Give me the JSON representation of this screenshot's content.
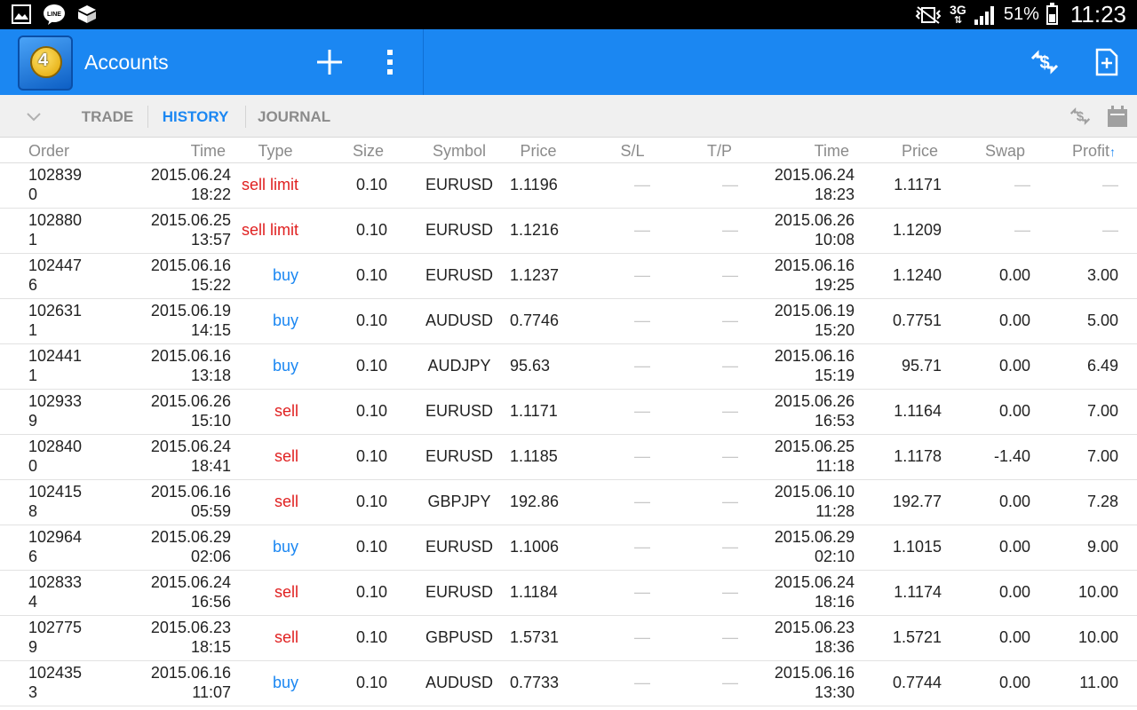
{
  "status_bar": {
    "battery": "51%",
    "network": "3G",
    "time": "11:23"
  },
  "action_bar": {
    "title": "Accounts"
  },
  "tabs": [
    {
      "label": "TRADE",
      "active": false
    },
    {
      "label": "HISTORY",
      "active": true
    },
    {
      "label": "JOURNAL",
      "active": false
    }
  ],
  "columns": {
    "order": "Order",
    "time": "Time",
    "type": "Type",
    "size": "Size",
    "symbol": "Symbol",
    "price": "Price",
    "sl": "S/L",
    "tp": "T/P",
    "close_time": "Time",
    "close_price": "Price",
    "swap": "Swap",
    "profit": "Profit",
    "sort_indicator": "↑"
  },
  "colors": {
    "accent": "#1b87f2",
    "buy": "#1b87f2",
    "sell": "#e02020"
  },
  "rows": [
    {
      "order_a": "102839",
      "order_b": "0",
      "date": "2015.06.24",
      "time": "18:22",
      "type": "sell limit",
      "size": "0.10",
      "symbol": "EURUSD",
      "price": "1.1196",
      "sl": "—",
      "tp": "—",
      "close_date": "2015.06.24",
      "close_time": "18:23",
      "close_price": "1.1171",
      "swap": "—",
      "profit": "—"
    },
    {
      "order_a": "102880",
      "order_b": "1",
      "date": "2015.06.25",
      "time": "13:57",
      "type": "sell limit",
      "size": "0.10",
      "symbol": "EURUSD",
      "price": "1.1216",
      "sl": "—",
      "tp": "—",
      "close_date": "2015.06.26",
      "close_time": "10:08",
      "close_price": "1.1209",
      "swap": "—",
      "profit": "—"
    },
    {
      "order_a": "102447",
      "order_b": "6",
      "date": "2015.06.16",
      "time": "15:22",
      "type": "buy",
      "size": "0.10",
      "symbol": "EURUSD",
      "price": "1.1237",
      "sl": "—",
      "tp": "—",
      "close_date": "2015.06.16",
      "close_time": "19:25",
      "close_price": "1.1240",
      "swap": "0.00",
      "profit": "3.00"
    },
    {
      "order_a": "102631",
      "order_b": "1",
      "date": "2015.06.19",
      "time": "14:15",
      "type": "buy",
      "size": "0.10",
      "symbol": "AUDUSD",
      "price": "0.7746",
      "sl": "—",
      "tp": "—",
      "close_date": "2015.06.19",
      "close_time": "15:20",
      "close_price": "0.7751",
      "swap": "0.00",
      "profit": "5.00"
    },
    {
      "order_a": "102441",
      "order_b": "1",
      "date": "2015.06.16",
      "time": "13:18",
      "type": "buy",
      "size": "0.10",
      "symbol": "AUDJPY",
      "price": "95.63",
      "sl": "—",
      "tp": "—",
      "close_date": "2015.06.16",
      "close_time": "15:19",
      "close_price": "95.71",
      "swap": "0.00",
      "profit": "6.49"
    },
    {
      "order_a": "102933",
      "order_b": "9",
      "date": "2015.06.26",
      "time": "15:10",
      "type": "sell",
      "size": "0.10",
      "symbol": "EURUSD",
      "price": "1.1171",
      "sl": "—",
      "tp": "—",
      "close_date": "2015.06.26",
      "close_time": "16:53",
      "close_price": "1.1164",
      "swap": "0.00",
      "profit": "7.00"
    },
    {
      "order_a": "102840",
      "order_b": "0",
      "date": "2015.06.24",
      "time": "18:41",
      "type": "sell",
      "size": "0.10",
      "symbol": "EURUSD",
      "price": "1.1185",
      "sl": "—",
      "tp": "—",
      "close_date": "2015.06.25",
      "close_time": "11:18",
      "close_price": "1.1178",
      "swap": "-1.40",
      "profit": "7.00"
    },
    {
      "order_a": "102415",
      "order_b": "8",
      "date": "2015.06.16",
      "time": "05:59",
      "type": "sell",
      "size": "0.10",
      "symbol": "GBPJPY",
      "price": "192.86",
      "sl": "—",
      "tp": "—",
      "close_date": "2015.06.10",
      "close_time": "11:28",
      "close_price": "192.77",
      "swap": "0.00",
      "profit": "7.28"
    },
    {
      "order_a": "102964",
      "order_b": "6",
      "date": "2015.06.29",
      "time": "02:06",
      "type": "buy",
      "size": "0.10",
      "symbol": "EURUSD",
      "price": "1.1006",
      "sl": "—",
      "tp": "—",
      "close_date": "2015.06.29",
      "close_time": "02:10",
      "close_price": "1.1015",
      "swap": "0.00",
      "profit": "9.00"
    },
    {
      "order_a": "102833",
      "order_b": "4",
      "date": "2015.06.24",
      "time": "16:56",
      "type": "sell",
      "size": "0.10",
      "symbol": "EURUSD",
      "price": "1.1184",
      "sl": "—",
      "tp": "—",
      "close_date": "2015.06.24",
      "close_time": "18:16",
      "close_price": "1.1174",
      "swap": "0.00",
      "profit": "10.00"
    },
    {
      "order_a": "102775",
      "order_b": "9",
      "date": "2015.06.23",
      "time": "18:15",
      "type": "sell",
      "size": "0.10",
      "symbol": "GBPUSD",
      "price": "1.5731",
      "sl": "—",
      "tp": "—",
      "close_date": "2015.06.23",
      "close_time": "18:36",
      "close_price": "1.5721",
      "swap": "0.00",
      "profit": "10.00"
    },
    {
      "order_a": "102435",
      "order_b": "3",
      "date": "2015.06.16",
      "time": "11:07",
      "type": "buy",
      "size": "0.10",
      "symbol": "AUDUSD",
      "price": "0.7733",
      "sl": "—",
      "tp": "—",
      "close_date": "2015.06.16",
      "close_time": "13:30",
      "close_price": "0.7744",
      "swap": "0.00",
      "profit": "11.00"
    }
  ]
}
